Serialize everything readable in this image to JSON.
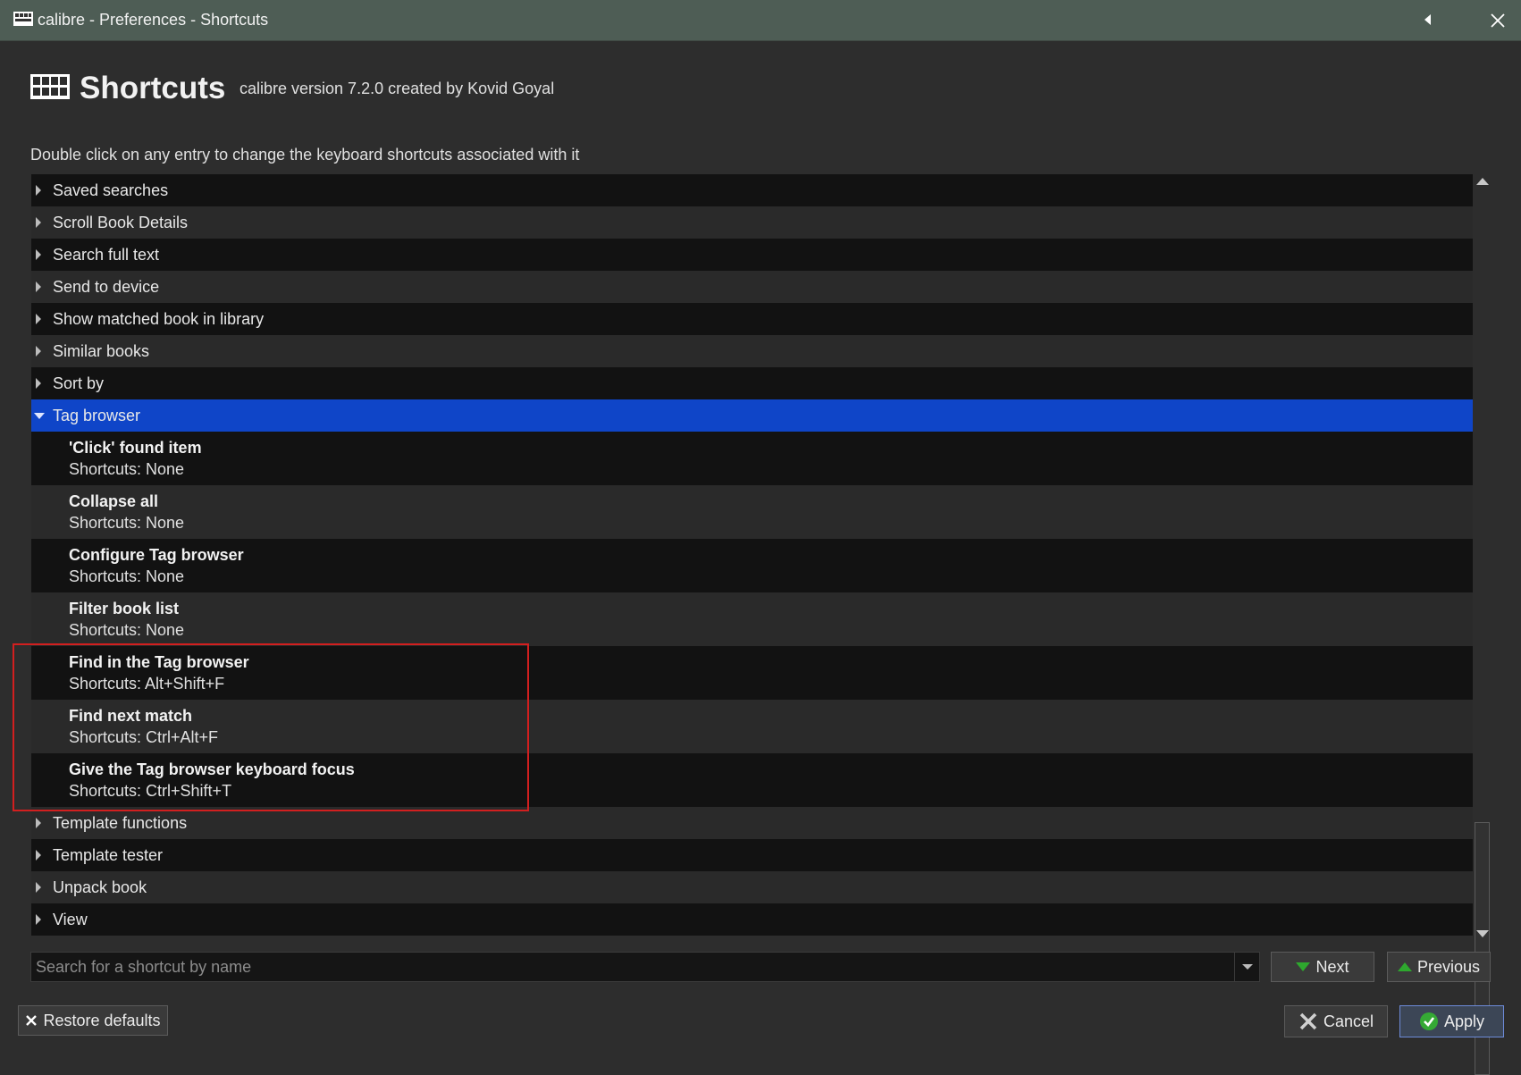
{
  "window": {
    "title": "calibre - Preferences - Shortcuts"
  },
  "header": {
    "title": "Shortcuts",
    "subtitle": "calibre version 7.2.0 created by Kovid Goyal"
  },
  "instructions": "Double click on any entry to change the keyboard shortcuts associated with it",
  "tree": {
    "before": [
      {
        "label": "Saved searches"
      },
      {
        "label": "Scroll Book Details"
      },
      {
        "label": "Search full text"
      },
      {
        "label": "Send to device"
      },
      {
        "label": "Show matched book in library"
      },
      {
        "label": "Similar books"
      },
      {
        "label": "Sort by"
      }
    ],
    "expanded": {
      "label": "Tag browser",
      "children": [
        {
          "name": "'Click' found item",
          "shortcut": "Shortcuts: None"
        },
        {
          "name": "Collapse all",
          "shortcut": "Shortcuts: None"
        },
        {
          "name": "Configure Tag browser",
          "shortcut": "Shortcuts: None"
        },
        {
          "name": "Filter book list",
          "shortcut": "Shortcuts: None"
        },
        {
          "name": "Find in the Tag browser",
          "shortcut": "Shortcuts: Alt+Shift+F"
        },
        {
          "name": "Find next match",
          "shortcut": "Shortcuts: Ctrl+Alt+F"
        },
        {
          "name": "Give the Tag browser keyboard focus",
          "shortcut": "Shortcuts: Ctrl+Shift+T"
        }
      ]
    },
    "after": [
      {
        "label": "Template functions"
      },
      {
        "label": "Template tester"
      },
      {
        "label": "Unpack book"
      },
      {
        "label": "View"
      }
    ]
  },
  "search": {
    "placeholder": "Search for a shortcut by name",
    "value": ""
  },
  "buttons": {
    "next": "Next",
    "previous": "Previous",
    "restore_defaults": "Restore defaults",
    "cancel": "Cancel",
    "apply": "Apply"
  },
  "colors": {
    "selection": "#0f45c8",
    "titlebar": "#4e5d55",
    "highlight_box": "#d21f1f",
    "nav_arrow": "#2ea82e"
  },
  "icons": {
    "title": "calibre-keyboard-icon",
    "header": "keyboard-icon",
    "collapse": "triangle-left-icon",
    "close": "close-icon",
    "next": "green-down-arrow-icon",
    "previous": "green-up-arrow-icon",
    "restore": "x-icon",
    "cancel": "x-icon",
    "apply": "checkmark-icon"
  }
}
